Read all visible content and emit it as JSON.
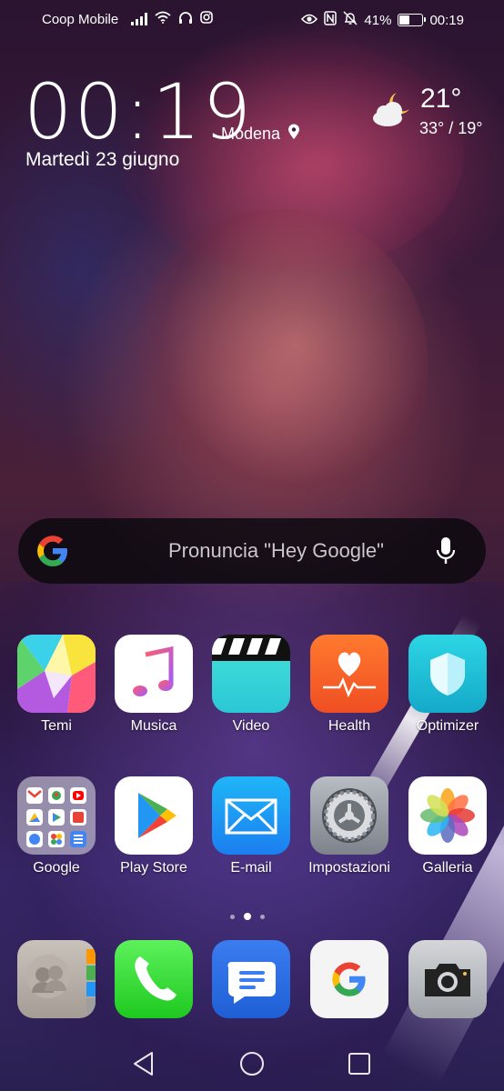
{
  "status_bar": {
    "carrier": "Coop Mobile",
    "battery_percent": "41%",
    "battery_level": 0.41,
    "time": "00:19",
    "left_icons": [
      "signal-icon",
      "wifi-icon",
      "headphones-icon",
      "instagram-icon"
    ],
    "right_icons": [
      "eye-icon",
      "nfc-icon",
      "bell-off-icon",
      "battery-icon"
    ]
  },
  "clock_widget": {
    "time": "00:19",
    "date": "Martedì 23 giugno",
    "city": "Modena",
    "weather_icon": "partly-cloudy-night-icon",
    "temperature": "21°",
    "range": "33° / 19°"
  },
  "search": {
    "placeholder": "Pronuncia \"Hey Google\""
  },
  "apps": {
    "row1": [
      {
        "label": "Temi",
        "icon": "themes-icon"
      },
      {
        "label": "Musica",
        "icon": "music-icon"
      },
      {
        "label": "Video",
        "icon": "video-icon"
      },
      {
        "label": "Health",
        "icon": "health-icon"
      },
      {
        "label": "Optimizer",
        "icon": "optimizer-icon"
      }
    ],
    "row2": [
      {
        "label": "Google",
        "icon": "google-folder-icon"
      },
      {
        "label": "Play Store",
        "icon": "play-store-icon"
      },
      {
        "label": "E-mail",
        "icon": "email-icon"
      },
      {
        "label": "Impostazioni",
        "icon": "settings-icon"
      },
      {
        "label": "Galleria",
        "icon": "gallery-icon"
      }
    ]
  },
  "page_indicator": {
    "count": 3,
    "active": 2
  },
  "dock": [
    "contacts-icon",
    "phone-icon",
    "messages-icon",
    "google-icon",
    "camera-icon"
  ],
  "nav": [
    "back-icon",
    "home-icon",
    "recents-icon"
  ]
}
